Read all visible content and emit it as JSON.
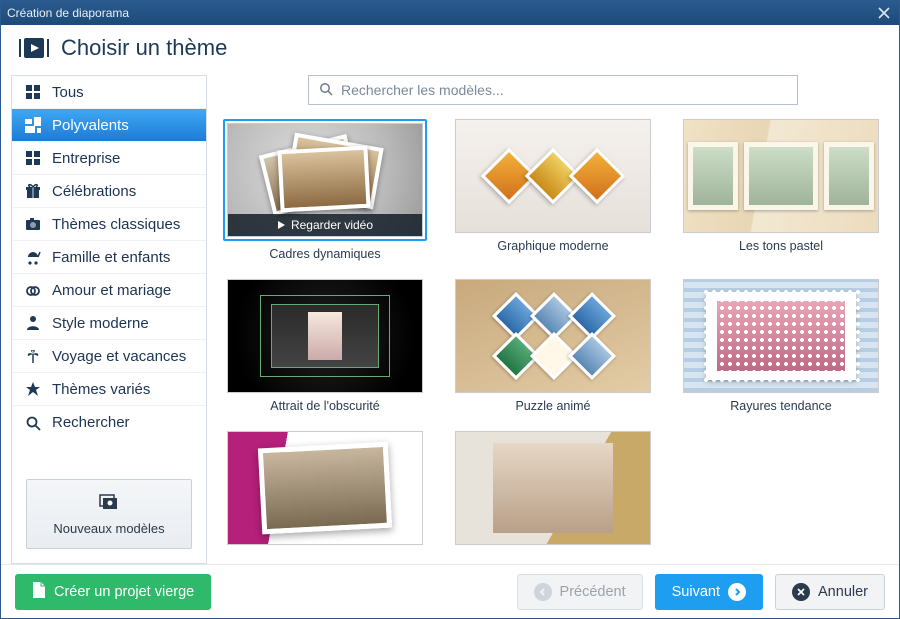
{
  "window": {
    "title": "Création de diaporama"
  },
  "header": {
    "title": "Choisir un thème"
  },
  "search": {
    "placeholder": "Rechercher les modèles..."
  },
  "sidebar": {
    "items": [
      {
        "label": "Tous",
        "icon": "grid-icon"
      },
      {
        "label": "Polyvalents",
        "icon": "tiles-icon",
        "selected": true
      },
      {
        "label": "Entreprise",
        "icon": "grid-icon"
      },
      {
        "label": "Célébrations",
        "icon": "gift-icon"
      },
      {
        "label": "Thèmes classiques",
        "icon": "camera-icon"
      },
      {
        "label": "Famille et enfants",
        "icon": "stroller-icon"
      },
      {
        "label": "Amour et mariage",
        "icon": "rings-icon"
      },
      {
        "label": "Style moderne",
        "icon": "person-icon"
      },
      {
        "label": "Voyage et vacances",
        "icon": "palm-icon"
      },
      {
        "label": "Thèmes variés",
        "icon": "star-icon"
      },
      {
        "label": "Rechercher",
        "icon": "search-icon"
      }
    ],
    "new_models": "Nouveaux modèles"
  },
  "templates": [
    {
      "label": "Cadres dynamiques",
      "watch": "Regarder vidéo",
      "selected": true
    },
    {
      "label": "Graphique moderne"
    },
    {
      "label": "Les tons pastel"
    },
    {
      "label": "Attrait de l'obscurité"
    },
    {
      "label": "Puzzle animé"
    },
    {
      "label": "Rayures tendance"
    },
    {
      "label": ""
    },
    {
      "label": ""
    }
  ],
  "footer": {
    "create_blank": "Créer un projet vierge",
    "prev": "Précédent",
    "next": "Suivant",
    "cancel": "Annuler"
  }
}
